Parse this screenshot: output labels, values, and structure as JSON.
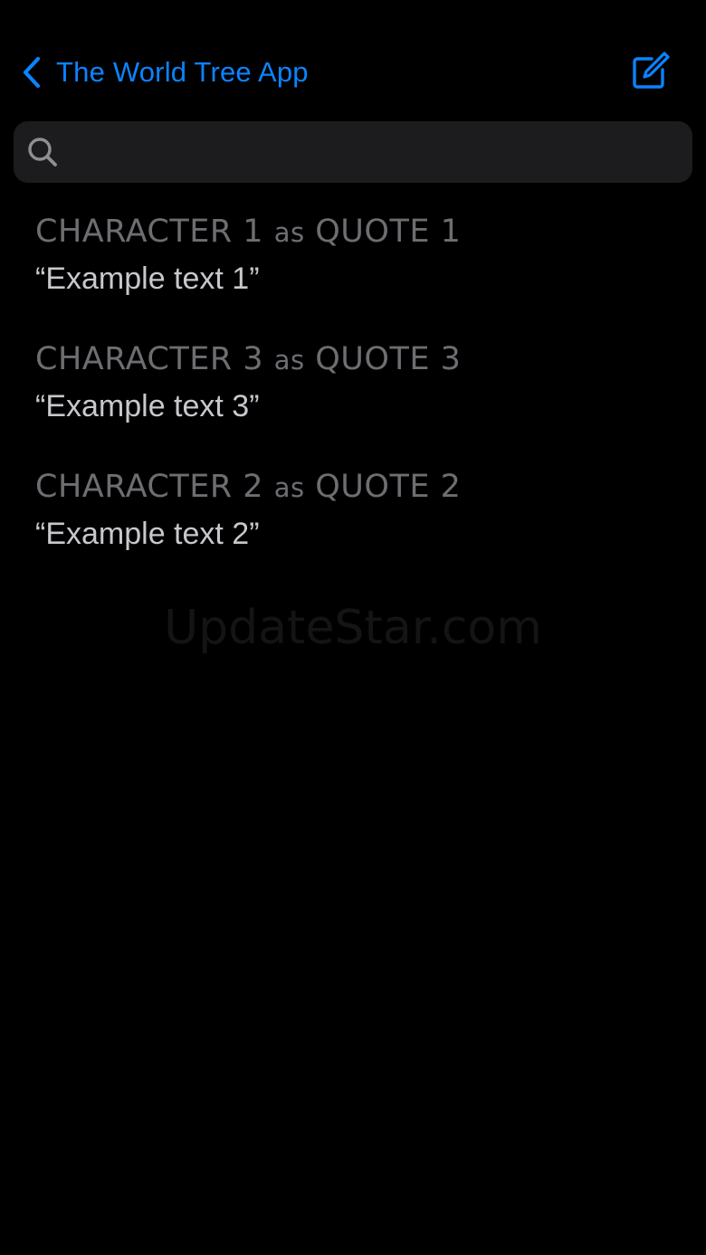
{
  "nav": {
    "back_label": "The World Tree App",
    "accent_color": "#0A84FF",
    "back_icon": "chevron-left-icon",
    "compose_icon": "compose-icon"
  },
  "search": {
    "placeholder": "",
    "value": "",
    "icon": "search-icon"
  },
  "items": [
    {
      "character": "CHARACTER 1",
      "connector": "as",
      "quote": "QUOTE 1",
      "text": "“Example text 1”"
    },
    {
      "character": "CHARACTER 3",
      "connector": "as",
      "quote": "QUOTE 3",
      "text": "“Example text 3”"
    },
    {
      "character": "CHARACTER 2",
      "connector": "as",
      "quote": "QUOTE 2",
      "text": "“Example text 2”"
    }
  ],
  "watermark": "UpdateStar.com"
}
